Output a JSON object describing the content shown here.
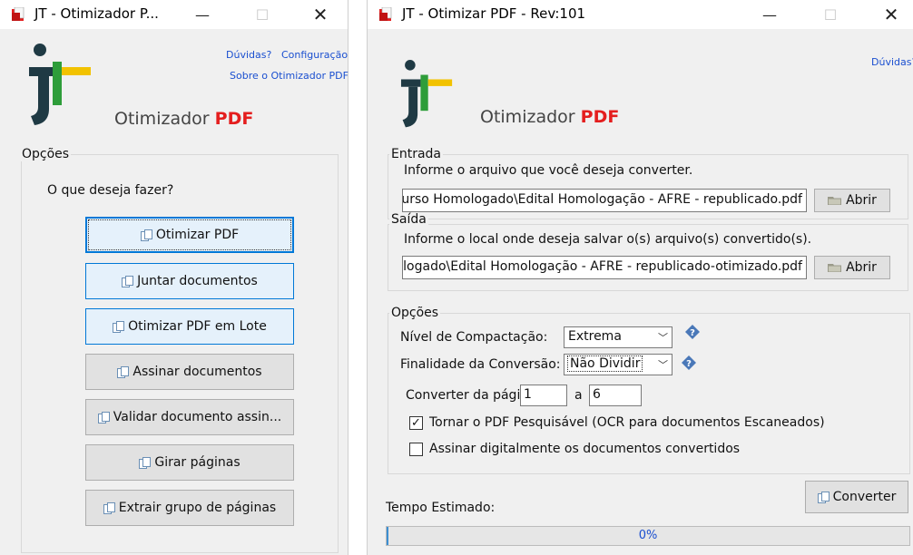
{
  "window1": {
    "title": "JT - Otimizador P...",
    "links": {
      "duvidas": "Dúvidas?",
      "configuracao": "Configuração",
      "sobre": "Sobre o Otimizador PDF"
    },
    "brand": {
      "name": "Otimizador",
      "pdf": "PDF"
    },
    "options_title": "Opções",
    "question": "O que deseja fazer?",
    "buttons": [
      {
        "label": "Otimizar PDF"
      },
      {
        "label": "Juntar documentos"
      },
      {
        "label": "Otimizar PDF em Lote"
      },
      {
        "label": "Assinar documentos"
      },
      {
        "label": "Validar documento assin..."
      },
      {
        "label": "Girar páginas"
      },
      {
        "label": "Extrair grupo de páginas"
      }
    ]
  },
  "window2": {
    "title": "JT - Otimizar PDF - Rev:101",
    "links": {
      "duvidas": "Dúvidas?"
    },
    "brand": {
      "name": "Otimizador",
      "pdf": "PDF"
    },
    "entrada": {
      "title": "Entrada",
      "prompt": "Informe o arquivo que você deseja converter.",
      "value": "urso Homologado\\Edital Homologação - AFRE - republicado.pdf",
      "button": "Abrir"
    },
    "saida": {
      "title": "Saída",
      "prompt": "Informe o local onde deseja salvar o(s) arquivo(s) convertido(s).",
      "value": "logado\\Edital Homologação - AFRE - republicado-otimizado.pdf",
      "button": "Abrir"
    },
    "opcoes": {
      "title": "Opções",
      "compactacao_label": "Nível de Compactação:",
      "compactacao_value": "Extrema",
      "finalidade_label": "Finalidade da Conversão:",
      "finalidade_value": "Não Dividir",
      "converter_label": "Converter da págir",
      "page_from": "1",
      "page_sep": "a",
      "page_to": "6",
      "ocr_label": "Tornar o PDF Pesquisável (OCR para documentos Escaneados)",
      "ocr_checked": true,
      "assinar_label": "Assinar digitalmente os documentos convertidos",
      "assinar_checked": false
    },
    "converter_button": "Converter",
    "tempo_label": "Tempo Estimado:",
    "progress_text": "0%",
    "progress_value": 0.0
  },
  "colors": {
    "accent": "#0078d7",
    "pdf_red": "#e41e1e",
    "logo_dark": "#1f3a44",
    "logo_green": "#2e9d3a",
    "logo_yellow": "#f2c200"
  }
}
